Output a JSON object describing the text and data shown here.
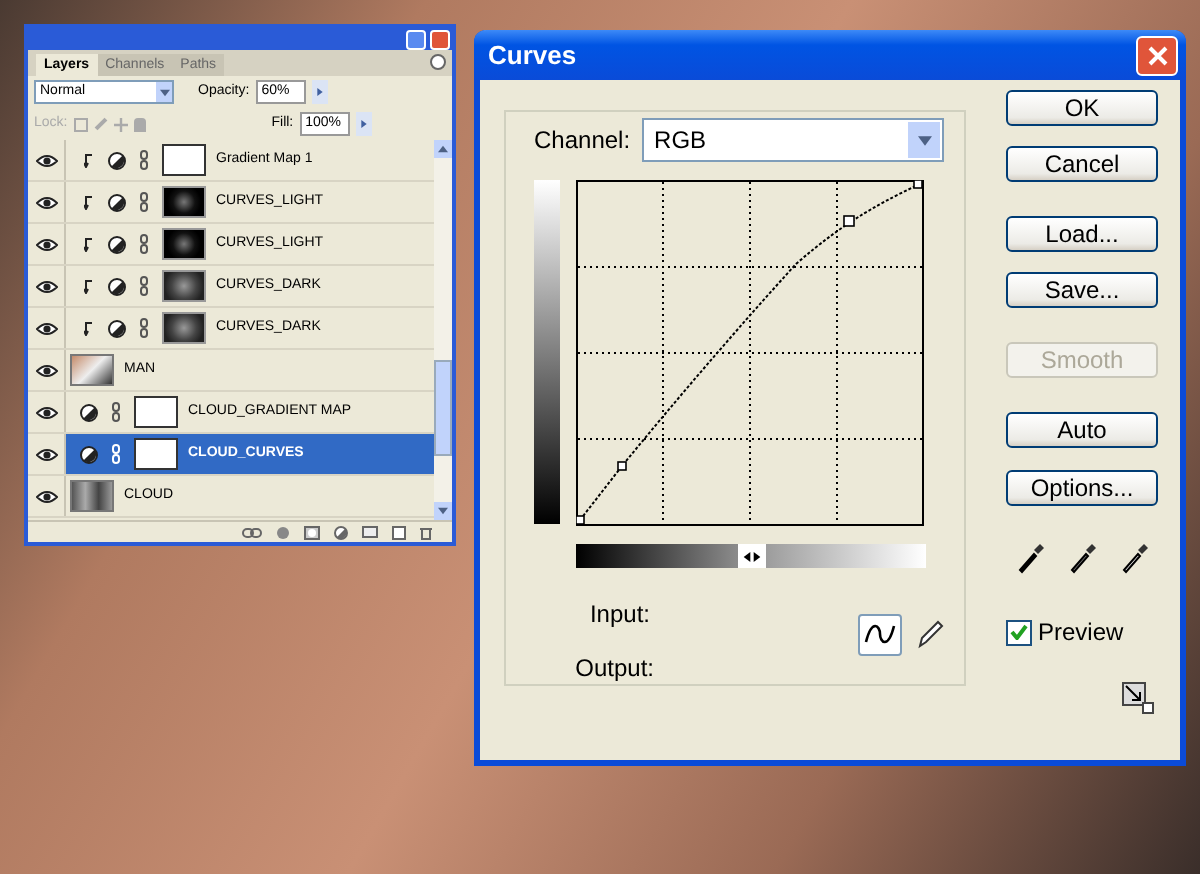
{
  "layers_panel": {
    "tabs": [
      {
        "label": "Layers",
        "selected": true
      },
      {
        "label": "Channels",
        "selected": false
      },
      {
        "label": "Paths",
        "selected": false
      }
    ],
    "blend_mode": "Normal",
    "opacity_label": "Opacity:",
    "opacity": "60%",
    "lock_label": "Lock:",
    "fill_label": "Fill:",
    "fill": "100%",
    "layers": [
      {
        "name": "Gradient Map 1",
        "kind": "clipped-adjustment",
        "thumbnail": {
          "kind": "white"
        },
        "visible": true,
        "selected": false
      },
      {
        "name": "CURVES_LIGHT",
        "kind": "clipped-adjustment",
        "thumbnail": {
          "kind": "dark"
        },
        "visible": true,
        "selected": false
      },
      {
        "name": "CURVES_LIGHT",
        "kind": "clipped-adjustment",
        "thumbnail": {
          "kind": "dark"
        },
        "visible": true,
        "selected": false
      },
      {
        "name": "CURVES_DARK",
        "kind": "clipped-adjustment",
        "thumbnail": {
          "kind": "grey"
        },
        "visible": true,
        "selected": false
      },
      {
        "name": "CURVES_DARK",
        "kind": "clipped-adjustment",
        "thumbnail": {
          "kind": "grey"
        },
        "visible": true,
        "selected": false
      },
      {
        "name": "MAN",
        "kind": "image",
        "thumbnail": {
          "kind": "photo"
        },
        "visible": true,
        "selected": false
      },
      {
        "name": "CLOUD_GRADIENT MAP",
        "kind": "adjustment",
        "thumbnail": {
          "kind": "white"
        },
        "visible": true,
        "selected": false
      },
      {
        "name": "CLOUD_CURVES",
        "kind": "adjustment",
        "thumbnail": {
          "kind": "white"
        },
        "visible": true,
        "selected": true
      },
      {
        "name": "CLOUD",
        "kind": "image",
        "thumbnail": {
          "kind": "texture"
        },
        "visible": true,
        "selected": false
      }
    ]
  },
  "curves_dialog": {
    "title": "Curves",
    "channel_label": "Channel:",
    "channel": "RGB",
    "input_label": "Input:",
    "output_label": "Output:",
    "tools": [
      {
        "kind": "curve",
        "selected": true
      },
      {
        "kind": "pencil",
        "selected": false
      }
    ],
    "buttons": [
      {
        "label": "OK",
        "disabled": false
      },
      {
        "label": "Cancel",
        "disabled": false
      },
      {
        "label": "Load...",
        "disabled": false
      },
      {
        "label": "Save...",
        "disabled": false
      },
      {
        "label": "Smooth",
        "disabled": true
      },
      {
        "label": "Auto",
        "disabled": false
      },
      {
        "label": "Options...",
        "disabled": false
      }
    ],
    "preview": {
      "label": "Preview",
      "checked": true
    }
  }
}
